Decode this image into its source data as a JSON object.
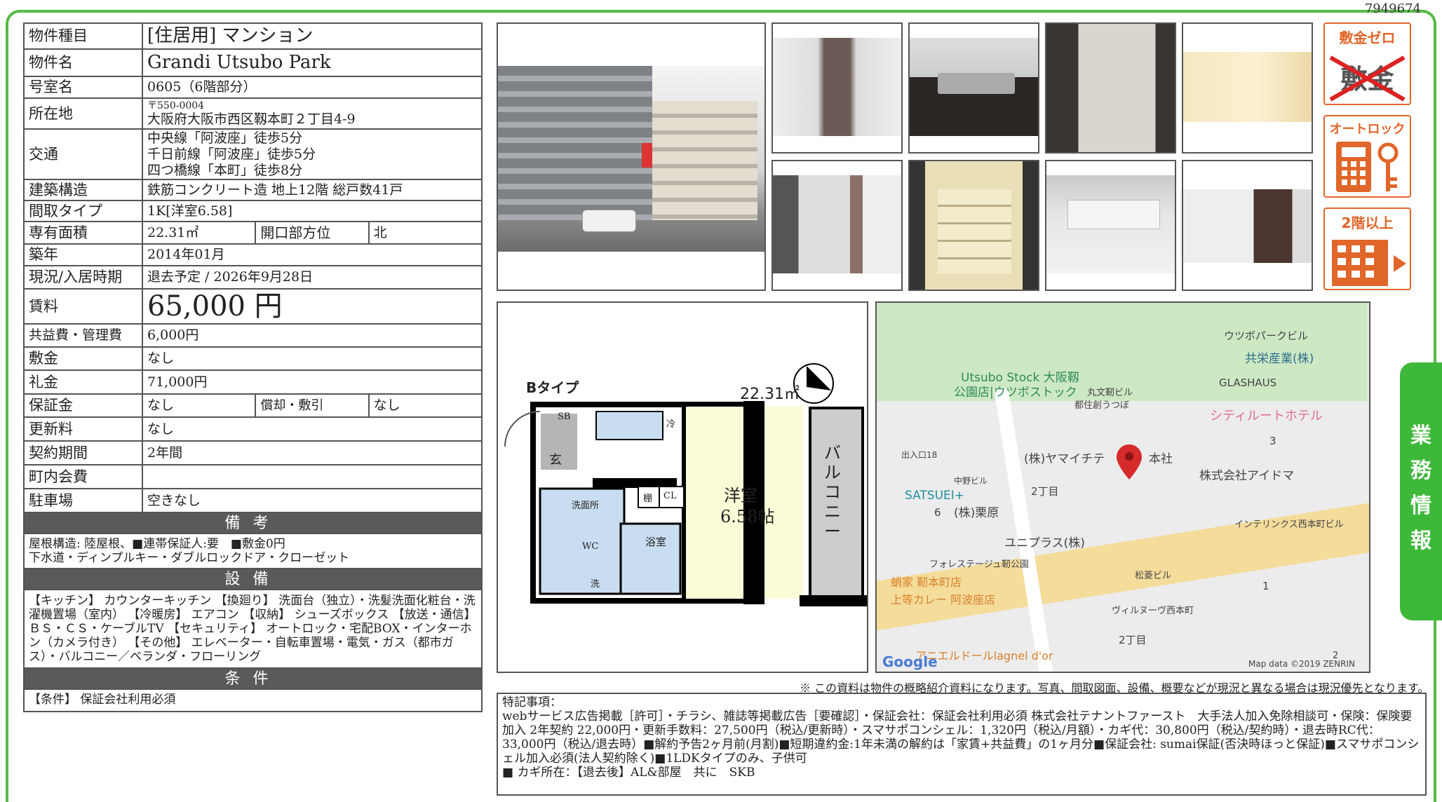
{
  "doc_id": "7949674",
  "property": {
    "type_label": "物件種目",
    "type_value": "[住居用] マンション",
    "name_label": "物件名",
    "name_value": "Grandi Utsubo Park",
    "room_label": "号室名",
    "room_value": "0605（6階部分）",
    "address_label": "所在地",
    "zip": "〒550-0004",
    "address": "大阪府大阪市西区靱本町２丁目4-9",
    "transit_label": "交通",
    "transit": [
      "中央線「阿波座」徒歩5分",
      "千日前線「阿波座」徒歩5分",
      "四つ橋線「本町」徒歩8分"
    ],
    "structure_label": "建築構造",
    "structure_value": "鉄筋コンクリート造 地上12階 総戸数41戸",
    "layout_label": "間取タイプ",
    "layout_value": "1K[洋室6.58]",
    "area_label": "専有面積",
    "area_value": "22.31㎡",
    "direction_label": "開口部方位",
    "direction_value": "北",
    "built_label": "築年",
    "built_value": "2014年01月",
    "status_label": "現況/入居時期",
    "status_value": "退去予定 / 2026年9月28日",
    "rent_label": "賃料",
    "rent_value": "65,000 円",
    "fee_label": "共益費・管理費",
    "fee_value": "6,000円",
    "deposit_label": "敷金",
    "deposit_value": "なし",
    "keymoney_label": "礼金",
    "keymoney_value": "71,000円",
    "guarantee_label": "保証金",
    "guarantee_value": "なし",
    "amort_label": "償却・敷引",
    "amort_value": "なし",
    "renewal_label": "更新料",
    "renewal_value": "なし",
    "contract_label": "契約期間",
    "contract_value": "2年間",
    "town_label": "町内会費",
    "town_value": "",
    "parking_label": "駐車場",
    "parking_value": "空きなし"
  },
  "remarks": {
    "header": "備考",
    "line1": "屋根構造: 陸屋根、■連帯保証人:要　■敷金0円",
    "line2": "下水道・ディンプルキー・ダブルロックドア・クローゼット"
  },
  "equipment": {
    "header": "設備",
    "text": "【キッチン】 カウンターキッチン 【換廻り】 洗面台（独立）・洗髪洗面化粧台・洗濯機置場（室内） 【冷暖房】 エアコン 【収納】 シューズボックス 【放送・通信】 ＢＳ・ＣＳ・ケーブルTV 【セキュリティ】 オートロック・宅配BOX・インターホン（カメラ付き） 【その他】 エレベーター・自転車置場・電気・ガス（都市ガス）・バルコニー／ベランダ・フローリング"
  },
  "conditions": {
    "header": "条件",
    "text": "【条件】 保証会社利用必須"
  },
  "badges": {
    "zero_deposit": "敷金ゼロ",
    "zero_deposit_crossed": "敷金",
    "autolock": "オートロック",
    "floor2": "2階以上"
  },
  "floorplan": {
    "type": "Bタイプ",
    "area": "22.31㎡",
    "room": "洋室",
    "room_size": "6.58帖",
    "balcony": "バルコニー",
    "entry": "玄",
    "sb": "SB",
    "fridge": "冷",
    "senmen": "洗面所",
    "wc": "WC",
    "bath": "浴室",
    "wash": "洗",
    "cl": "CL",
    "shelf": "棚"
  },
  "map": {
    "labels": [
      "ウツボパークビル",
      "共栄産業(株)",
      "GLASHAUS",
      "Utsubo Stock 大阪靱",
      "公園店|ウツボストック",
      "丸文靭ビル",
      "都住創うつぼ",
      "シティルートホテル",
      "出入口18",
      "(株)ヤマイチテ",
      "本社",
      "株式会社アイドマ",
      "中野ビル",
      "2丁目",
      "3",
      "SATSUEI+",
      "6",
      "(株)栗原",
      "ユニプラス(株)",
      "インテリンクス西本町ビル",
      "フォレステージュ靭公園",
      "蛸家 靭本町店",
      "上等カレー 阿波座店",
      "松菱ビル",
      "1",
      "ヴィルヌーヴ西本町",
      "2丁目",
      "アニエルドールlagnel d'or",
      "2"
    ],
    "google": "Google",
    "copyright": "Map data ©2019 ZENRIN"
  },
  "note": "※ この資料は物件の概略紹介資料になります。写真、間取図面、設備、概要などが現況と異なる場合は現況優先となります。",
  "special": {
    "title": "特記事項：",
    "text": "webサービス広告掲載［許可］・チラシ、雑誌等掲載広告［要確認］・保証会社：保証会社利用必須 株式会社テナントファースト　大手法人加入免除相談可・保険：保険要加入 2年契約 22,000円・更新手数料：27,500円（税込/更新時）・スマサポコンシェル：1,320円（税込/月額）・カギ代：30,800円（税込/契約時）・退去時RC代：33,000円（税込/退去時）■解約予告2ヶ月前(月割)■短期違約金:1年未満の解約は「家賃+共益費」の1ヶ月分■保証会社: sumai保証(否決時ほっと保証)■スマサポコンシェル加入必須(法人契約除く)■1LDKタイプのみ、子供可",
    "key": "■ カギ所在：【退去後】AL&部屋　共に　SKB"
  },
  "side_tab": "業務情報",
  "colors": {
    "frame": "#55bb44",
    "badge": "#e0662a",
    "header": "#5a5a5a",
    "tab": "#3db83a"
  }
}
